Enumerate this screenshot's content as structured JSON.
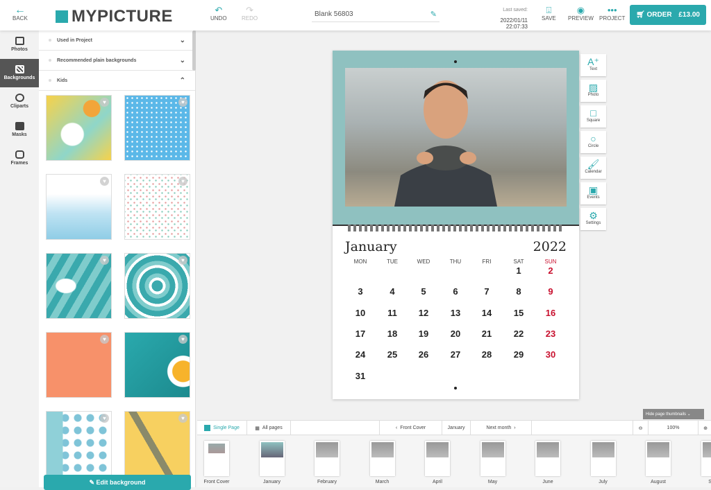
{
  "header": {
    "back": "BACK",
    "logo": "MYPICTURE",
    "undo": "UNDO",
    "redo": "REDO",
    "project_title": "Blank 56803",
    "last_saved_label": "Last saved:",
    "last_saved": "2022/01/11 22:07:33",
    "save": "SAVE",
    "preview": "PREVIEW",
    "project": "PROJECT",
    "order": "ORDER",
    "price": "£13.00"
  },
  "rail": [
    {
      "label": "Photos"
    },
    {
      "label": "Backgrounds",
      "active": true
    },
    {
      "label": "Cliparts"
    },
    {
      "label": "Masks"
    },
    {
      "label": "Frames"
    }
  ],
  "panel": {
    "sections": [
      "Used in Project",
      "Recommended plain backgrounds",
      "Kids"
    ],
    "edit_button": "Edit background"
  },
  "calendar": {
    "month": "January",
    "year": "2022",
    "weekdays": [
      "MON",
      "TUE",
      "WED",
      "THU",
      "FRI",
      "SAT",
      "SUN"
    ],
    "days": [
      "",
      "",
      "",
      "",
      "",
      "1",
      "2",
      "3",
      "4",
      "5",
      "6",
      "7",
      "8",
      "9",
      "10",
      "11",
      "12",
      "13",
      "14",
      "15",
      "16",
      "17",
      "18",
      "19",
      "20",
      "21",
      "22",
      "23",
      "24",
      "25",
      "26",
      "27",
      "28",
      "29",
      "30",
      "31"
    ],
    "sunday_color": "#c8102e"
  },
  "tools": [
    "Text",
    "Photo",
    "Square",
    "Circle",
    "Calendar",
    "Events",
    "Settings"
  ],
  "bottom": {
    "hide_thumbnails": "Hide page thumbnails",
    "single_page": "Single Page",
    "all_pages": "All pages",
    "prev": "Front Cover",
    "current": "January",
    "next": "Next month",
    "zoom": "100%"
  },
  "thumbnails": [
    "Front Cover",
    "January",
    "February",
    "March",
    "April",
    "May",
    "June",
    "July",
    "August",
    "Sept"
  ],
  "accent": "#2aa9ad"
}
